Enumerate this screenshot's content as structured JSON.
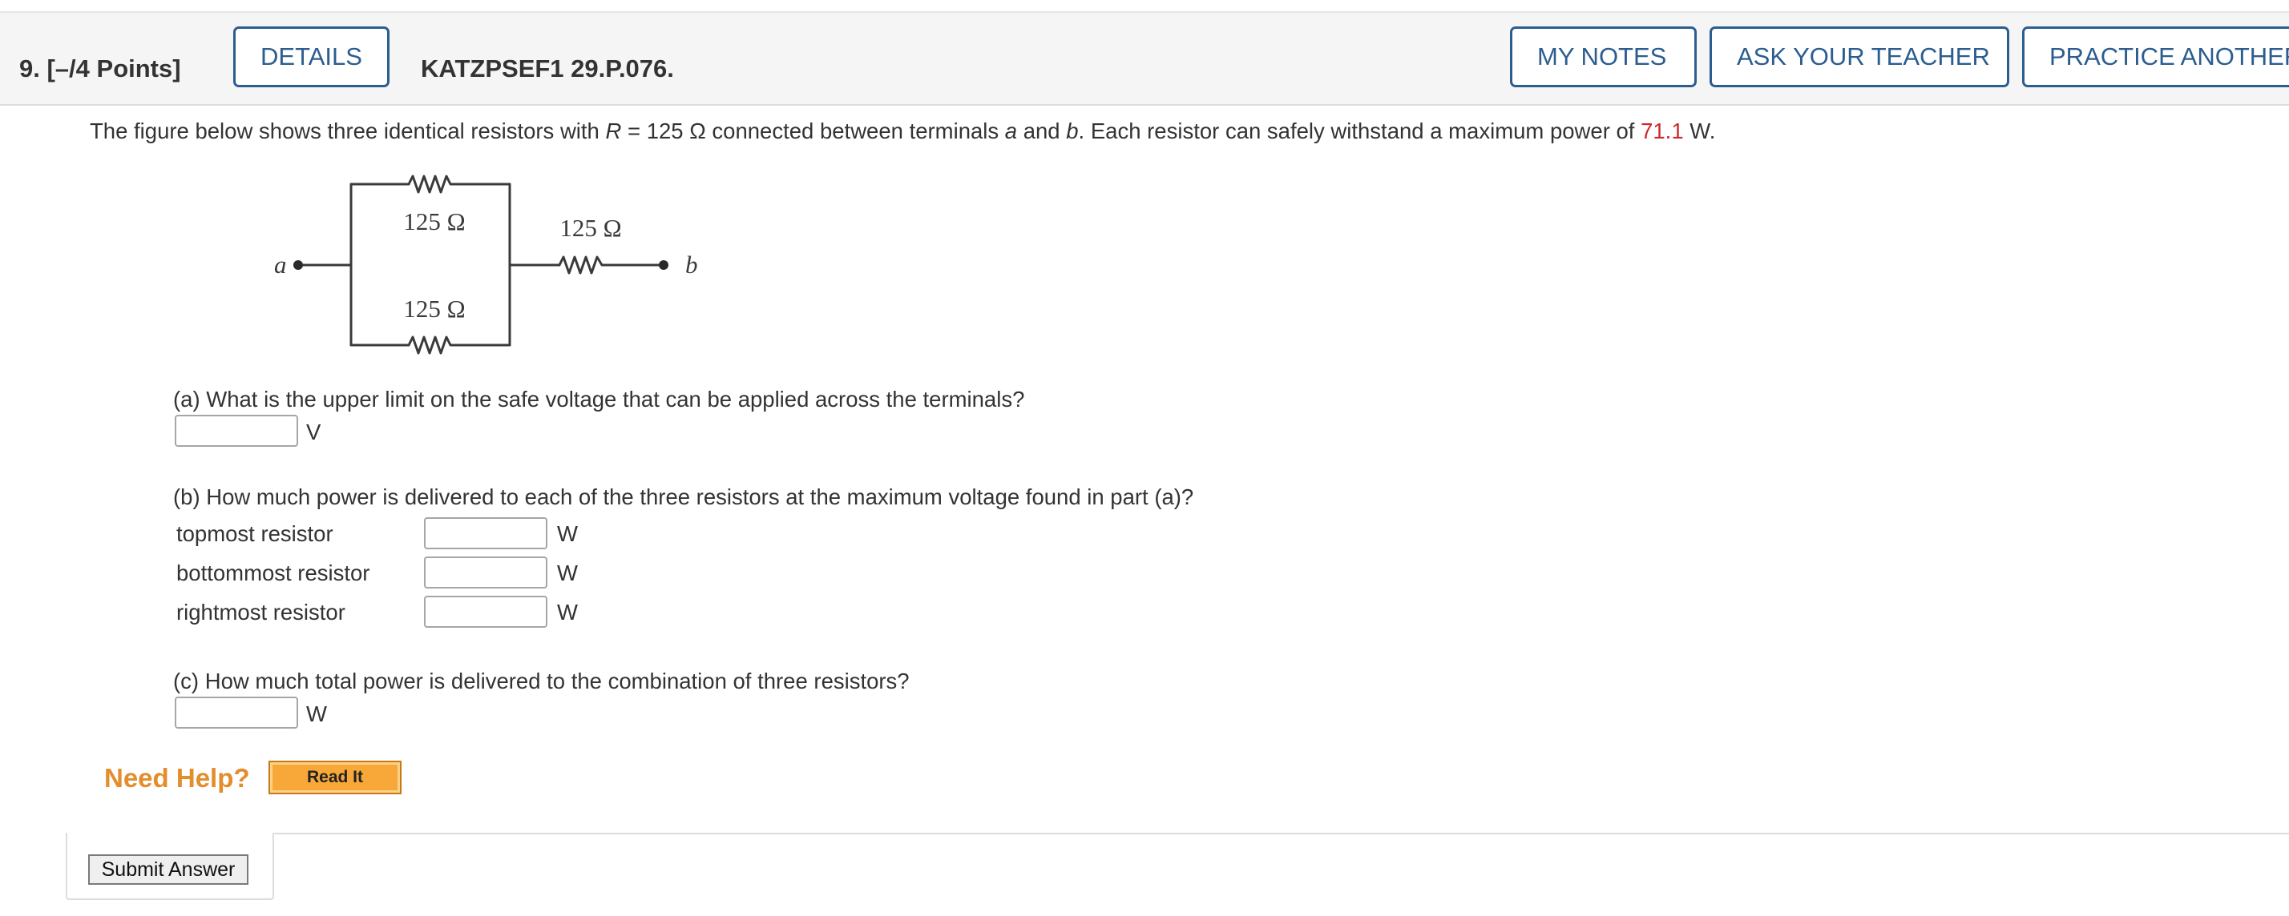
{
  "header": {
    "question_number": "9.",
    "points": "[–/4 Points]",
    "details_label": "DETAILS",
    "problem_id": "KATZPSEF1 29.P.076.",
    "my_notes_label": "MY NOTES",
    "ask_teacher_label": "ASK YOUR TEACHER",
    "practice_label": "PRACTICE ANOTHER"
  },
  "problem": {
    "intro_part1": "The figure below shows three identical resistors with ",
    "symbol_R": "R",
    "intro_part2": " = 125 Ω  connected between terminals ",
    "term_a": "a",
    "intro_and": " and ",
    "term_b": "b",
    "intro_part3": ". Each resistor can safely withstand a maximum power of ",
    "max_power_value": "71.1",
    "intro_unit": " W."
  },
  "circuit": {
    "top_label": "125 Ω",
    "bottom_label": "125 Ω",
    "right_label": "125 Ω",
    "terminal_a": "a",
    "terminal_b": "b"
  },
  "part_a": {
    "question": "(a) What is the upper limit on the safe voltage that can be applied across the terminals?",
    "unit": "V",
    "value": ""
  },
  "part_b": {
    "question": "(b) How much power is delivered to each of the three resistors at the maximum voltage found in part (a)?",
    "rows": [
      {
        "label": "topmost resistor",
        "unit": "W",
        "value": ""
      },
      {
        "label": "bottommost resistor",
        "unit": "W",
        "value": ""
      },
      {
        "label": "rightmost resistor",
        "unit": "W",
        "value": ""
      }
    ]
  },
  "part_c": {
    "question": "(c) How much total power is delivered to the combination of three resistors?",
    "unit": "W",
    "value": ""
  },
  "help": {
    "need_help_label": "Need Help?",
    "read_it_label": "Read It"
  },
  "actions": {
    "submit_label": "Submit Answer"
  },
  "colors": {
    "accent_blue": "#2c5d8f",
    "value_red": "#d1262b",
    "help_orange": "#e38d2d",
    "read_it_bg": "#f7a839"
  }
}
